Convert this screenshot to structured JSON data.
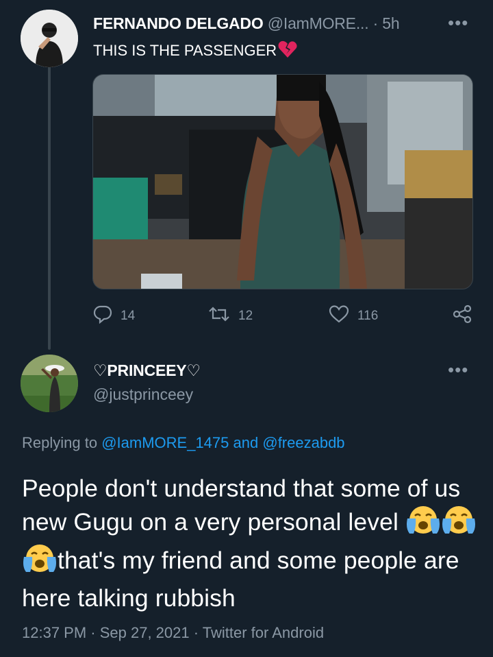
{
  "tweet": {
    "author_name": "FERNANDO DELGADO",
    "author_handle": "@IamMORE...",
    "time_sep": "·",
    "time": "5h",
    "more": "•••",
    "text": "THIS IS THE PASSENGER",
    "emoji": "broken-heart",
    "actions": {
      "replies": "14",
      "retweets": "12",
      "likes": "116"
    }
  },
  "reply": {
    "author_name": "♡PRINCEEY♡",
    "author_handle": "@justprinceey",
    "more": "•••",
    "replying_prefix": "Replying to",
    "replying_user1": "@IamMORE_1475",
    "replying_and": "and",
    "replying_user2": "@freezabdb",
    "text_1": "People don't understand that some of us new Gugu on a very personal level",
    "text_2": "that's my friend and some people are here talking rubbish",
    "emoji": [
      "loudly-crying-face",
      "loudly-crying-face",
      "loudly-crying-face"
    ],
    "timestamp": "12:37 PM · Sep 27, 2021 · Twitter for Android"
  },
  "colors": {
    "background": "#15202b",
    "muted": "#8b98a5",
    "link": "#1d9bf0"
  }
}
